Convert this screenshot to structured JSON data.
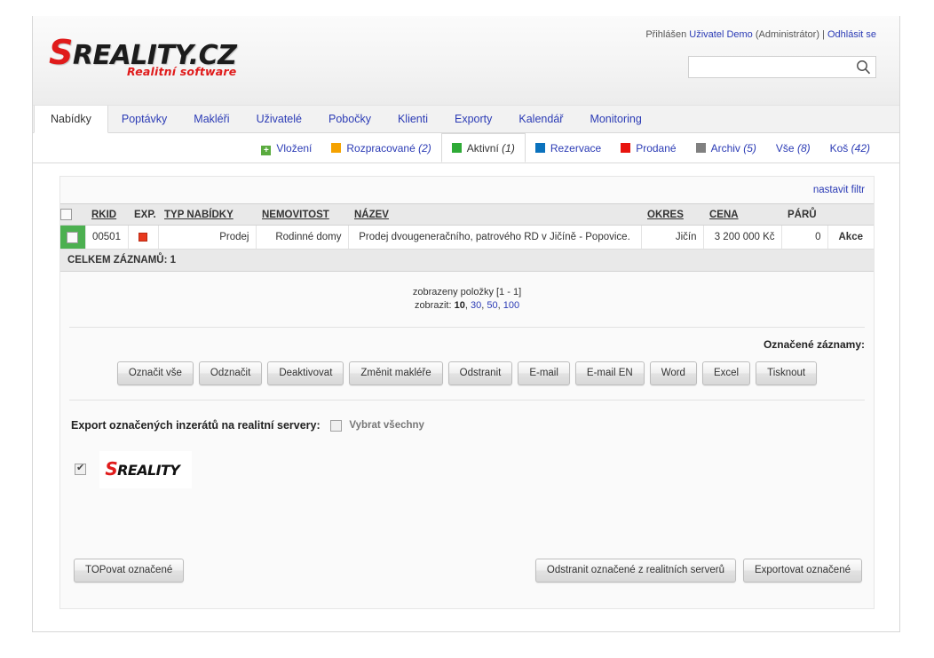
{
  "header": {
    "logo": {
      "s": "S",
      "rest": "REALITY.CZ",
      "subtitle": "Realitní software"
    },
    "login": {
      "prefix": "Přihlášen",
      "user": "Uživatel Demo",
      "role": "(Administrátor)",
      "separator": "|",
      "logout": "Odhlásit se"
    },
    "search": {
      "value": "",
      "placeholder": "",
      "icon": "search-icon"
    }
  },
  "nav": {
    "items": [
      {
        "label": "Nabídky",
        "active": true
      },
      {
        "label": "Poptávky",
        "active": false
      },
      {
        "label": "Makléři",
        "active": false
      },
      {
        "label": "Uživatelé",
        "active": false
      },
      {
        "label": "Pobočky",
        "active": false
      },
      {
        "label": "Klienti",
        "active": false
      },
      {
        "label": "Exporty",
        "active": false
      },
      {
        "label": "Kalendář",
        "active": false
      },
      {
        "label": "Monitoring",
        "active": false
      }
    ]
  },
  "subtabs": {
    "items": [
      {
        "label": "Vložení",
        "count": "",
        "color": "#5aab3f",
        "icon": "plus-icon",
        "active": false
      },
      {
        "label": "Rozpracované",
        "count": "(2)",
        "color": "#f5a200",
        "icon": "square-icon",
        "active": false
      },
      {
        "label": "Aktivní",
        "count": "(1)",
        "color": "#2eaa36",
        "icon": "square-icon",
        "active": true
      },
      {
        "label": "Rezervace",
        "count": "",
        "color": "#0b72bd",
        "icon": "square-icon",
        "active": false
      },
      {
        "label": "Prodané",
        "count": "",
        "color": "#e8140e",
        "icon": "square-icon",
        "active": false
      },
      {
        "label": "Archiv",
        "count": "(5)",
        "color": "#808080",
        "icon": "square-icon",
        "active": false
      },
      {
        "label": "Vše",
        "count": "(8)",
        "color": "",
        "icon": "",
        "active": false
      },
      {
        "label": "Koš",
        "count": "(42)",
        "color": "",
        "icon": "",
        "active": false
      }
    ]
  },
  "panel": {
    "filter_link": "nastavit filtr",
    "table": {
      "columns": [
        {
          "label": "",
          "key": "check"
        },
        {
          "label": "RKID",
          "key": "rkid"
        },
        {
          "label": "EXP.",
          "key": "exp"
        },
        {
          "label": "TYP NABÍDKY",
          "key": "typ"
        },
        {
          "label": "NEMOVITOST",
          "key": "nem"
        },
        {
          "label": "NÁZEV",
          "key": "naz"
        },
        {
          "label": "OKRES",
          "key": "okr"
        },
        {
          "label": "CENA",
          "key": "cena"
        },
        {
          "label": "PÁRŮ",
          "key": "paru"
        },
        {
          "label": "",
          "key": "akce"
        }
      ],
      "rows": [
        {
          "selected": true,
          "rkid": "00501",
          "exp": "red-square-icon",
          "typ": "Prodej",
          "nem": "Rodinné domy",
          "naz": "Prodej dvougeneračního, patrového RD v Jičíně - Popovice.",
          "okr": "Jičín",
          "cena": "3 200 000 Kč",
          "paru": "0",
          "akce": "Akce"
        }
      ],
      "total_label": "CELKEM ZÁZNAMŮ: 1"
    },
    "pager": {
      "shown": "zobrazeny položky [1 - 1]",
      "show_label": "zobrazit:",
      "options": [
        "10",
        "30",
        "50",
        "100"
      ],
      "current": "10"
    },
    "selected_records_label": "Označené záznamy:",
    "action_buttons": [
      "Označit vše",
      "Odznačit",
      "Deaktivovat",
      "Změnit makléře",
      "Odstranit",
      "E-mail",
      "E-mail EN",
      "Word",
      "Excel",
      "Tisknout"
    ],
    "export": {
      "title": "Export označených inzerátů na realitní servery:",
      "select_all_label": "Vybrat všechny",
      "select_all_checked": false,
      "servers": [
        {
          "name": "SREALITY",
          "checked": true,
          "logo_s": "S",
          "logo_rest": "REALITY"
        }
      ]
    },
    "bottom_buttons": {
      "top": "TOPovat označené",
      "remove": "Odstranit označené z realitních serverů",
      "export": "Exportovat označené"
    }
  }
}
